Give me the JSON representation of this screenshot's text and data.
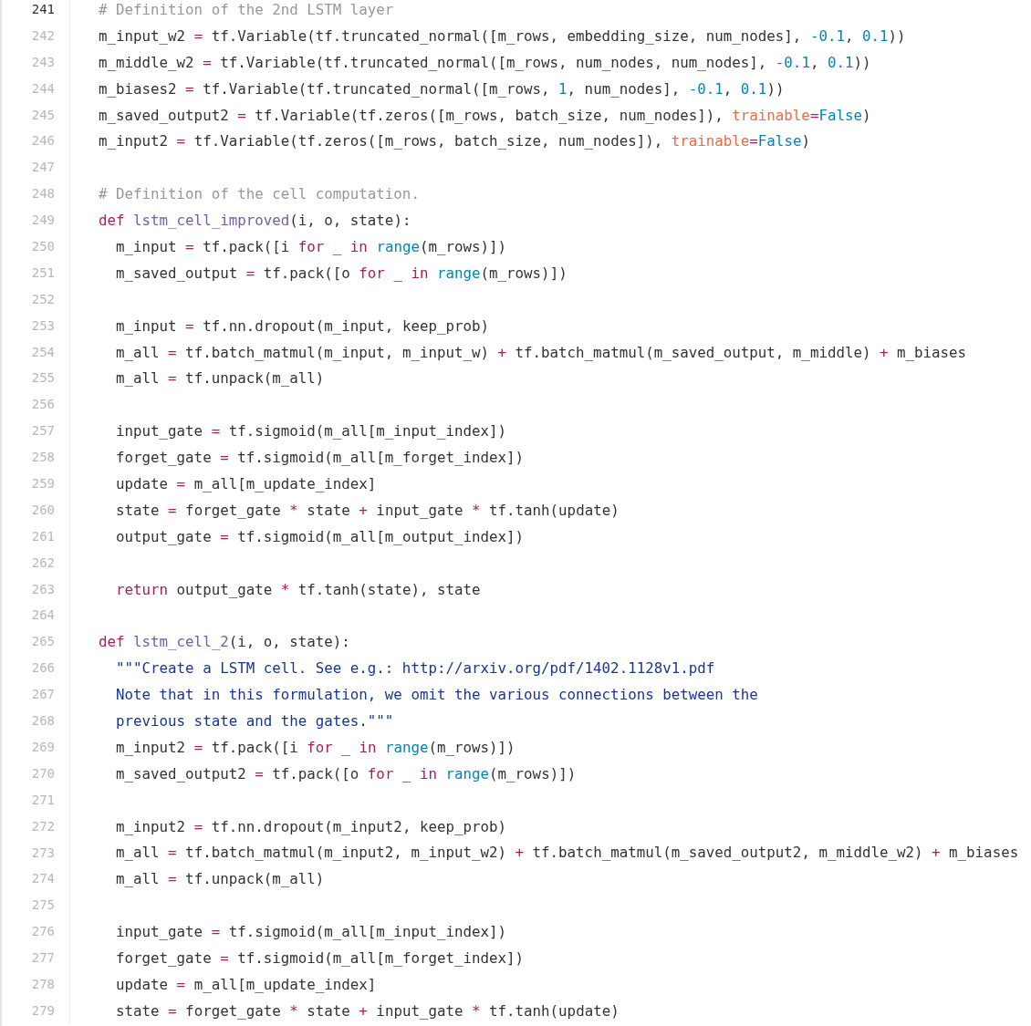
{
  "code_view": {
    "lines": [
      {
        "number": "241",
        "active": true,
        "tokens": [
          {
            "kind": "comment",
            "text": "# Definition of the 2nd LSTM layer"
          }
        ]
      },
      {
        "number": "242",
        "active": false,
        "tokens": [
          {
            "kind": "plain",
            "text": "m_input_w2 "
          },
          {
            "kind": "operator",
            "text": "="
          },
          {
            "kind": "plain",
            "text": " tf.Variable(tf.truncated_normal([m_rows, embedding_size, num_nodes], "
          },
          {
            "kind": "number",
            "text": "-0.1"
          },
          {
            "kind": "plain",
            "text": ", "
          },
          {
            "kind": "number",
            "text": "0.1"
          },
          {
            "kind": "plain",
            "text": "))"
          }
        ]
      },
      {
        "number": "243",
        "active": false,
        "tokens": [
          {
            "kind": "plain",
            "text": "m_middle_w2 "
          },
          {
            "kind": "operator",
            "text": "="
          },
          {
            "kind": "plain",
            "text": " tf.Variable(tf.truncated_normal([m_rows, num_nodes, num_nodes], "
          },
          {
            "kind": "number",
            "text": "-0.1"
          },
          {
            "kind": "plain",
            "text": ", "
          },
          {
            "kind": "number",
            "text": "0.1"
          },
          {
            "kind": "plain",
            "text": "))"
          }
        ]
      },
      {
        "number": "244",
        "active": false,
        "tokens": [
          {
            "kind": "plain",
            "text": "m_biases2 "
          },
          {
            "kind": "operator",
            "text": "="
          },
          {
            "kind": "plain",
            "text": " tf.Variable(tf.truncated_normal([m_rows, "
          },
          {
            "kind": "number",
            "text": "1"
          },
          {
            "kind": "plain",
            "text": ", num_nodes], "
          },
          {
            "kind": "number",
            "text": "-0.1"
          },
          {
            "kind": "plain",
            "text": ", "
          },
          {
            "kind": "number",
            "text": "0.1"
          },
          {
            "kind": "plain",
            "text": "))"
          }
        ]
      },
      {
        "number": "245",
        "active": false,
        "tokens": [
          {
            "kind": "plain",
            "text": "m_saved_output2 "
          },
          {
            "kind": "operator",
            "text": "="
          },
          {
            "kind": "plain",
            "text": " tf.Variable(tf.zeros([m_rows, batch_size, num_nodes]), "
          },
          {
            "kind": "kwarg",
            "text": "trainable"
          },
          {
            "kind": "operator",
            "text": "="
          },
          {
            "kind": "constant",
            "text": "False"
          },
          {
            "kind": "plain",
            "text": ")"
          }
        ]
      },
      {
        "number": "246",
        "active": false,
        "tokens": [
          {
            "kind": "plain",
            "text": "m_input2 "
          },
          {
            "kind": "operator",
            "text": "="
          },
          {
            "kind": "plain",
            "text": " tf.Variable(tf.zeros([m_rows, batch_size, num_nodes]), "
          },
          {
            "kind": "kwarg",
            "text": "trainable"
          },
          {
            "kind": "operator",
            "text": "="
          },
          {
            "kind": "constant",
            "text": "False"
          },
          {
            "kind": "plain",
            "text": ")"
          }
        ]
      },
      {
        "number": "247",
        "active": false
      },
      {
        "number": "248",
        "active": false,
        "tokens": [
          {
            "kind": "comment",
            "text": "# Definition of the cell computation."
          }
        ]
      },
      {
        "number": "249",
        "active": false,
        "tokens": [
          {
            "kind": "keyword",
            "text": "def "
          },
          {
            "kind": "function",
            "text": "lstm_cell_improved"
          },
          {
            "kind": "plain",
            "text": "(i, o, state):"
          }
        ]
      },
      {
        "number": "250",
        "active": false,
        "tokens": [
          {
            "kind": "plain",
            "text": "  m_input "
          },
          {
            "kind": "operator",
            "text": "="
          },
          {
            "kind": "plain",
            "text": " tf.pack([i "
          },
          {
            "kind": "keyword",
            "text": "for"
          },
          {
            "kind": "plain",
            "text": " _ "
          },
          {
            "kind": "keyword",
            "text": "in "
          },
          {
            "kind": "builtin",
            "text": "range"
          },
          {
            "kind": "plain",
            "text": "(m_rows)])"
          }
        ]
      },
      {
        "number": "251",
        "active": false,
        "tokens": [
          {
            "kind": "plain",
            "text": "  m_saved_output "
          },
          {
            "kind": "operator",
            "text": "="
          },
          {
            "kind": "plain",
            "text": " tf.pack([o "
          },
          {
            "kind": "keyword",
            "text": "for"
          },
          {
            "kind": "plain",
            "text": " _ "
          },
          {
            "kind": "keyword",
            "text": "in "
          },
          {
            "kind": "builtin",
            "text": "range"
          },
          {
            "kind": "plain",
            "text": "(m_rows)])"
          }
        ]
      },
      {
        "number": "252",
        "active": false
      },
      {
        "number": "253",
        "active": false,
        "tokens": [
          {
            "kind": "plain",
            "text": "  m_input "
          },
          {
            "kind": "operator",
            "text": "="
          },
          {
            "kind": "plain",
            "text": " tf.nn.dropout(m_input, keep_prob)"
          }
        ]
      },
      {
        "number": "254",
        "active": false,
        "tokens": [
          {
            "kind": "plain",
            "text": "  m_all "
          },
          {
            "kind": "operator",
            "text": "="
          },
          {
            "kind": "plain",
            "text": " tf.batch_matmul(m_input, m_input_w) "
          },
          {
            "kind": "operator",
            "text": "+"
          },
          {
            "kind": "plain",
            "text": " tf.batch_matmul(m_saved_output, m_middle) "
          },
          {
            "kind": "operator",
            "text": "+"
          },
          {
            "kind": "plain",
            "text": " m_biases"
          }
        ]
      },
      {
        "number": "255",
        "active": false,
        "tokens": [
          {
            "kind": "plain",
            "text": "  m_all "
          },
          {
            "kind": "operator",
            "text": "="
          },
          {
            "kind": "plain",
            "text": " tf.unpack(m_all)"
          }
        ]
      },
      {
        "number": "256",
        "active": false
      },
      {
        "number": "257",
        "active": false,
        "tokens": [
          {
            "kind": "plain",
            "text": "  input_gate "
          },
          {
            "kind": "operator",
            "text": "="
          },
          {
            "kind": "plain",
            "text": " tf.sigmoid(m_all[m_input_index])"
          }
        ]
      },
      {
        "number": "258",
        "active": false,
        "tokens": [
          {
            "kind": "plain",
            "text": "  forget_gate "
          },
          {
            "kind": "operator",
            "text": "="
          },
          {
            "kind": "plain",
            "text": " tf.sigmoid(m_all[m_forget_index])"
          }
        ]
      },
      {
        "number": "259",
        "active": false,
        "tokens": [
          {
            "kind": "plain",
            "text": "  update "
          },
          {
            "kind": "operator",
            "text": "="
          },
          {
            "kind": "plain",
            "text": " m_all[m_update_index]"
          }
        ]
      },
      {
        "number": "260",
        "active": false,
        "tokens": [
          {
            "kind": "plain",
            "text": "  state "
          },
          {
            "kind": "operator",
            "text": "="
          },
          {
            "kind": "plain",
            "text": " forget_gate "
          },
          {
            "kind": "operator",
            "text": "*"
          },
          {
            "kind": "plain",
            "text": " state "
          },
          {
            "kind": "operator",
            "text": "+"
          },
          {
            "kind": "plain",
            "text": " input_gate "
          },
          {
            "kind": "operator",
            "text": "*"
          },
          {
            "kind": "plain",
            "text": " tf.tanh(update)"
          }
        ]
      },
      {
        "number": "261",
        "active": false,
        "tokens": [
          {
            "kind": "plain",
            "text": "  output_gate "
          },
          {
            "kind": "operator",
            "text": "="
          },
          {
            "kind": "plain",
            "text": " tf.sigmoid(m_all[m_output_index])"
          }
        ]
      },
      {
        "number": "262",
        "active": false
      },
      {
        "number": "263",
        "active": false,
        "tokens": [
          {
            "kind": "keyword",
            "text": "  return"
          },
          {
            "kind": "plain",
            "text": " output_gate "
          },
          {
            "kind": "operator",
            "text": "*"
          },
          {
            "kind": "plain",
            "text": " tf.tanh(state), state"
          }
        ]
      },
      {
        "number": "264",
        "active": false
      },
      {
        "number": "265",
        "active": false,
        "tokens": [
          {
            "kind": "keyword",
            "text": "def "
          },
          {
            "kind": "function",
            "text": "lstm_cell_2"
          },
          {
            "kind": "plain",
            "text": "(i, o, state):"
          }
        ]
      },
      {
        "number": "266",
        "active": false,
        "tokens": [
          {
            "kind": "string",
            "text": "  \"\"\"Create a LSTM cell. See e.g.: http://arxiv.org/pdf/1402.1128v1.pdf"
          }
        ]
      },
      {
        "number": "267",
        "active": false,
        "tokens": [
          {
            "kind": "string",
            "text": "  Note that in this formulation, we omit the various connections between the"
          }
        ]
      },
      {
        "number": "268",
        "active": false,
        "tokens": [
          {
            "kind": "string",
            "text": "  previous state and the gates.\"\"\""
          }
        ]
      },
      {
        "number": "269",
        "active": false,
        "tokens": [
          {
            "kind": "plain",
            "text": "  m_input2 "
          },
          {
            "kind": "operator",
            "text": "="
          },
          {
            "kind": "plain",
            "text": " tf.pack([i "
          },
          {
            "kind": "keyword",
            "text": "for"
          },
          {
            "kind": "plain",
            "text": " _ "
          },
          {
            "kind": "keyword",
            "text": "in "
          },
          {
            "kind": "builtin",
            "text": "range"
          },
          {
            "kind": "plain",
            "text": "(m_rows)])"
          }
        ]
      },
      {
        "number": "270",
        "active": false,
        "tokens": [
          {
            "kind": "plain",
            "text": "  m_saved_output2 "
          },
          {
            "kind": "operator",
            "text": "="
          },
          {
            "kind": "plain",
            "text": " tf.pack([o "
          },
          {
            "kind": "keyword",
            "text": "for"
          },
          {
            "kind": "plain",
            "text": " _ "
          },
          {
            "kind": "keyword",
            "text": "in "
          },
          {
            "kind": "builtin",
            "text": "range"
          },
          {
            "kind": "plain",
            "text": "(m_rows)])"
          }
        ]
      },
      {
        "number": "271",
        "active": false
      },
      {
        "number": "272",
        "active": false,
        "tokens": [
          {
            "kind": "plain",
            "text": "  m_input2 "
          },
          {
            "kind": "operator",
            "text": "="
          },
          {
            "kind": "plain",
            "text": " tf.nn.dropout(m_input2, keep_prob)"
          }
        ]
      },
      {
        "number": "273",
        "active": false,
        "tokens": [
          {
            "kind": "plain",
            "text": "  m_all "
          },
          {
            "kind": "operator",
            "text": "="
          },
          {
            "kind": "plain",
            "text": " tf.batch_matmul(m_input2, m_input_w2) "
          },
          {
            "kind": "operator",
            "text": "+"
          },
          {
            "kind": "plain",
            "text": " tf.batch_matmul(m_saved_output2, m_middle_w2) "
          },
          {
            "kind": "operator",
            "text": "+"
          },
          {
            "kind": "plain",
            "text": " m_biases"
          }
        ]
      },
      {
        "number": "274",
        "active": false,
        "tokens": [
          {
            "kind": "plain",
            "text": "  m_all "
          },
          {
            "kind": "operator",
            "text": "="
          },
          {
            "kind": "plain",
            "text": " tf.unpack(m_all)"
          }
        ]
      },
      {
        "number": "275",
        "active": false
      },
      {
        "number": "276",
        "active": false,
        "tokens": [
          {
            "kind": "plain",
            "text": "  input_gate "
          },
          {
            "kind": "operator",
            "text": "="
          },
          {
            "kind": "plain",
            "text": " tf.sigmoid(m_all[m_input_index])"
          }
        ]
      },
      {
        "number": "277",
        "active": false,
        "tokens": [
          {
            "kind": "plain",
            "text": "  forget_gate "
          },
          {
            "kind": "operator",
            "text": "="
          },
          {
            "kind": "plain",
            "text": " tf.sigmoid(m_all[m_forget_index])"
          }
        ]
      },
      {
        "number": "278",
        "active": false,
        "tokens": [
          {
            "kind": "plain",
            "text": "  update "
          },
          {
            "kind": "operator",
            "text": "="
          },
          {
            "kind": "plain",
            "text": " m_all[m_update_index]"
          }
        ]
      },
      {
        "number": "279",
        "active": false,
        "tokens": [
          {
            "kind": "plain",
            "text": "  state "
          },
          {
            "kind": "operator",
            "text": "="
          },
          {
            "kind": "plain",
            "text": " forget_gate "
          },
          {
            "kind": "operator",
            "text": "*"
          },
          {
            "kind": "plain",
            "text": " state "
          },
          {
            "kind": "operator",
            "text": "+"
          },
          {
            "kind": "plain",
            "text": " input_gate "
          },
          {
            "kind": "operator",
            "text": "*"
          },
          {
            "kind": "plain",
            "text": " tf.tanh(update)"
          }
        ]
      }
    ]
  }
}
